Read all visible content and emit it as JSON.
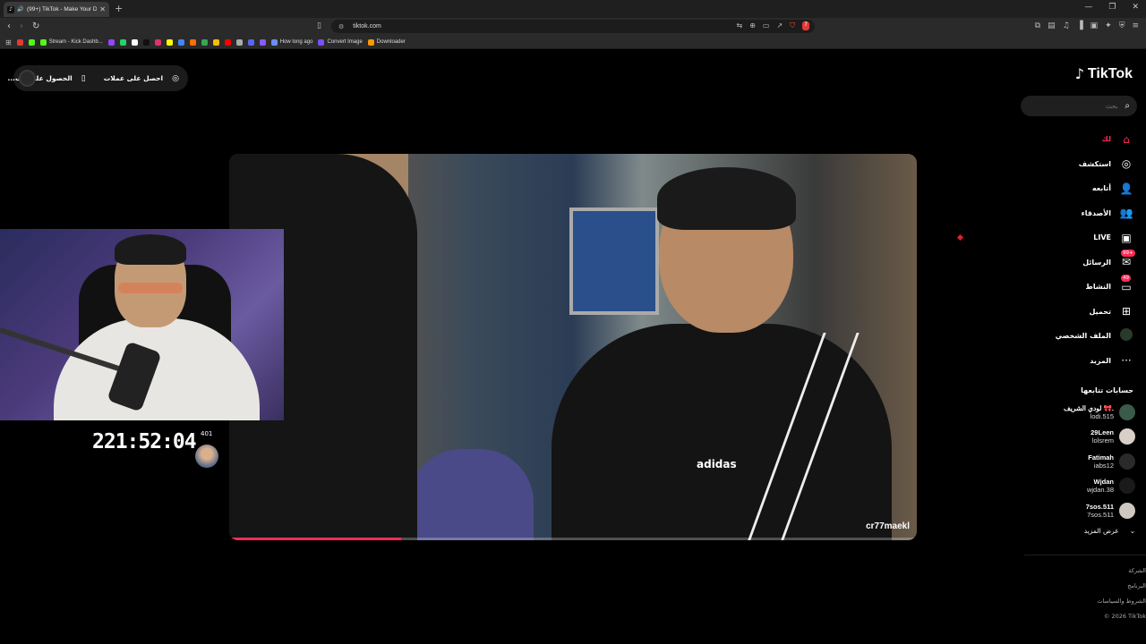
{
  "browser": {
    "tab_title": "(99+) TikTok - Make Your Day",
    "url": "tiktok.com",
    "bookmarks": [
      {
        "label": "",
        "color": "#e53935"
      },
      {
        "label": "",
        "color": "#53fc18"
      },
      {
        "label": "Stream - Kick Dashb...",
        "color": "#53fc18"
      },
      {
        "label": "",
        "color": "#9146ff"
      },
      {
        "label": "",
        "color": "#25d366"
      },
      {
        "label": "",
        "color": "#ffffff"
      },
      {
        "label": "",
        "color": "#111111"
      },
      {
        "label": "",
        "color": "#e1306c"
      },
      {
        "label": "",
        "color": "#fffc00"
      },
      {
        "label": "",
        "color": "#4285f4"
      },
      {
        "label": "",
        "color": "#ff6d00"
      },
      {
        "label": "",
        "color": "#34a853"
      },
      {
        "label": "",
        "color": "#fbbc05"
      },
      {
        "label": "",
        "color": "#ff0000"
      },
      {
        "label": "",
        "color": "#aaaaaa"
      },
      {
        "label": "",
        "color": "#5865f2"
      },
      {
        "label": "",
        "color": "#8a5cf6"
      },
      {
        "label": "How long ago",
        "color": "#6c8cff"
      },
      {
        "label": "Convert Image",
        "color": "#7c4dff"
      },
      {
        "label": "Downloader",
        "color": "#ff9800"
      }
    ],
    "notification_badge": "7"
  },
  "coins_bar": {
    "get_coins": "احصل على عملات",
    "get_app": "الحصول على الت..."
  },
  "video": {
    "watermark": "cr77maekl",
    "progress_fraction": 0.25,
    "shirt_logo": "adidas"
  },
  "stream_overlay": {
    "timer": "221:52:04",
    "count": "401"
  },
  "sidebar": {
    "logo_text": "TikTok",
    "search_placeholder": "بحث",
    "nav": [
      {
        "label": "لك",
        "icon": "home-icon",
        "active": true
      },
      {
        "label": "استكشف",
        "icon": "compass-icon"
      },
      {
        "label": "أتابعه",
        "icon": "user-follow-icon"
      },
      {
        "label": "الأصدقاء",
        "icon": "friends-icon"
      },
      {
        "label": "LIVE",
        "icon": "live-icon"
      },
      {
        "label": "الرسائل",
        "icon": "messages-icon",
        "badge": "99+"
      },
      {
        "label": "النشاط",
        "icon": "activity-icon",
        "badge": "49"
      },
      {
        "label": "تحميل",
        "icon": "upload-icon"
      },
      {
        "label": "الملف الشخصي",
        "icon": "profile-avatar-icon"
      },
      {
        "label": "المزيد",
        "icon": "more-icon"
      }
    ],
    "following_title": "حسابات تتابعها",
    "following": [
      {
        "name": "لودي الشريف 🎀.",
        "user": "lodi.515",
        "avatar_color": "#3a5a4a"
      },
      {
        "name": "29Leen",
        "user": "lolsrem",
        "avatar_color": "#d8d0c8"
      },
      {
        "name": "Fatimah",
        "user": "iabs12",
        "avatar_color": "#2a2a2a"
      },
      {
        "name": "Wjdan",
        "user": "wjdan.38",
        "avatar_color": "#1a1a1a"
      },
      {
        "name": "7sos.511",
        "user": "7sos.511",
        "avatar_color": "#cfc8c0"
      }
    ],
    "see_more": "عرض المزيد",
    "footer": [
      "الشركة",
      "البرنامج",
      "الشروط والسياسات",
      "© 2026 TikTok"
    ]
  }
}
